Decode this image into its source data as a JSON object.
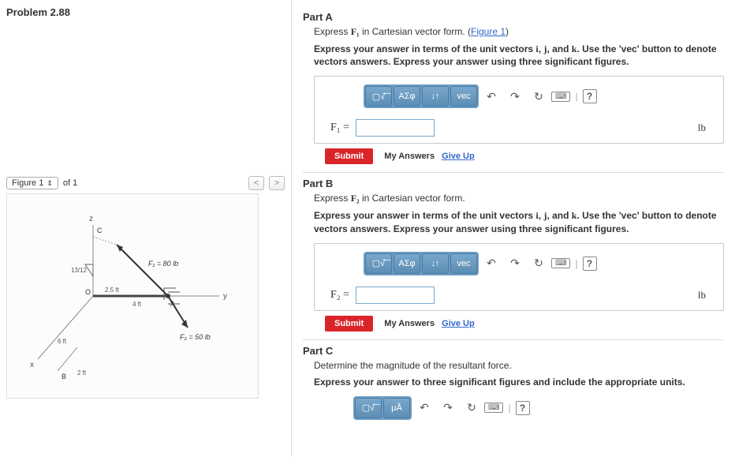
{
  "problem": {
    "title": "Problem 2.88"
  },
  "figure": {
    "select_label": "Figure 1",
    "of_label": "of 1",
    "prev": "<",
    "next": ">",
    "labels": {
      "z": "z",
      "y": "y",
      "x": "x",
      "C": "C",
      "O": "O",
      "A": "A",
      "B": "B",
      "F1": "F₁ = 80 lb",
      "F2": "F₂ = 50 lb",
      "d_2_5": "2.5 ft",
      "d_4": "4 ft",
      "d_6": "6 ft",
      "d_2": "2 ft",
      "slope": "13/12"
    }
  },
  "parts": {
    "a": {
      "title": "Part A",
      "prompt_pre": "Express ",
      "prompt_var": "F₁",
      "prompt_post": " in Cartesian vector form. (",
      "fig_link": "Figure 1",
      "prompt_close": ")",
      "instr": "Express your answer in terms of the unit vectors i, j, and k. Use the 'vec' button to denote vectors answers. Express your answer using three significant figures.",
      "label": "F₁ =",
      "unit": "lb",
      "value": ""
    },
    "b": {
      "title": "Part B",
      "prompt_pre": "Express ",
      "prompt_var": "F₂",
      "prompt_post": " in Cartesian vector form.",
      "instr": "Express your answer in terms of the unit vectors i, j, and k. Use the 'vec' button to denote vectors answers. Express your answer using three significant figures.",
      "label": "F₂ =",
      "unit": "lb",
      "value": ""
    },
    "c": {
      "title": "Part C",
      "prompt": "Determine the magnitude of the resultant force.",
      "instr": "Express your answer to three significant figures and include the appropriate units."
    }
  },
  "toolbar": {
    "template": "▢√͞",
    "greek": "ΑΣφ",
    "subscript": "↓↑",
    "vec": "vec",
    "undo": "↶",
    "redo": "↷",
    "reset": "↻",
    "keyboard": "⌨",
    "help": "?",
    "units_template": "▢√͞",
    "units": "μÅ"
  },
  "actions": {
    "submit": "Submit",
    "my_answers": "My Answers",
    "give_up": "Give Up"
  }
}
